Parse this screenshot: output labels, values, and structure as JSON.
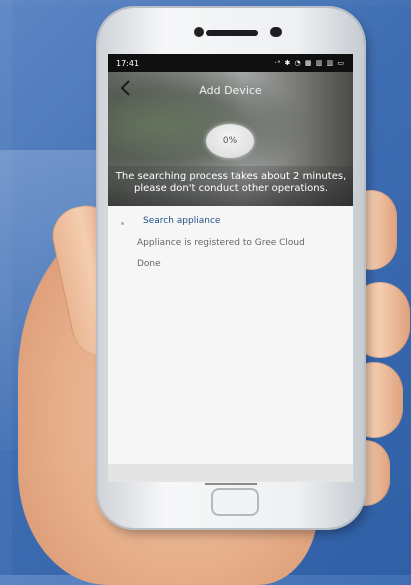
{
  "status_bar": {
    "time": "17:41",
    "icons_text": "·ᵃ ✱ ◔ ▦ ▥ ▥ ▭"
  },
  "header": {
    "title": "Add Device",
    "back_icon": "chevron-left-icon"
  },
  "progress": {
    "label": "0%",
    "value": 0
  },
  "hint": {
    "text": "The searching process takes about 2 minutes, please don't conduct other operations."
  },
  "steps": [
    {
      "label": "Search appliance",
      "state": "active"
    },
    {
      "label": "Appliance is registered to Gree Cloud",
      "state": "pending"
    },
    {
      "label": "Done",
      "state": "pending"
    }
  ],
  "colors": {
    "active_step": "#1f4f8a",
    "pending_step": "#666666",
    "screen_bg": "#f6f6f6"
  }
}
